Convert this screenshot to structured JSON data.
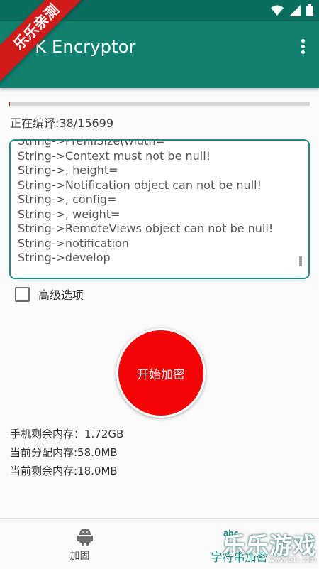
{
  "app": {
    "title": "APK Encryptor"
  },
  "ribbon": {
    "text": "乐乐亲测"
  },
  "progress": {
    "fraction": 0.0024
  },
  "compile": {
    "status": "正在编译:38/15699"
  },
  "log": {
    "lines": [
      "String->PrefillSize(width=",
      "String->Context must not be null!",
      "String->, height=",
      "String->Notification object can not be null!",
      "String->, config=",
      "String->, weight=",
      "String->RemoteViews object can not be null!",
      "String->notification",
      "String->develop"
    ]
  },
  "advanced": {
    "label": "高级选项",
    "checked": false
  },
  "encrypt_button": {
    "label": "开始加密",
    "color": "#f40404"
  },
  "memory": {
    "free_phone": "手机剩余内存：1.72GB",
    "allocated": "当前分配内存:58.0MB",
    "remaining": "当前剩余内存:18.0MB"
  },
  "bottom_nav": {
    "items": [
      {
        "label": "加固",
        "icon": "android-icon",
        "active": false
      },
      {
        "label": "字符串加密",
        "icon": "abc-icon",
        "icon_text": "abc",
        "active": true
      }
    ]
  },
  "watermark": {
    "title": "乐乐游戏",
    "url": "www.61l.com"
  },
  "colors": {
    "primary": "#11806f",
    "primary_dark": "#0b6c60",
    "accent": "#1d8f80",
    "danger": "#f40404"
  }
}
